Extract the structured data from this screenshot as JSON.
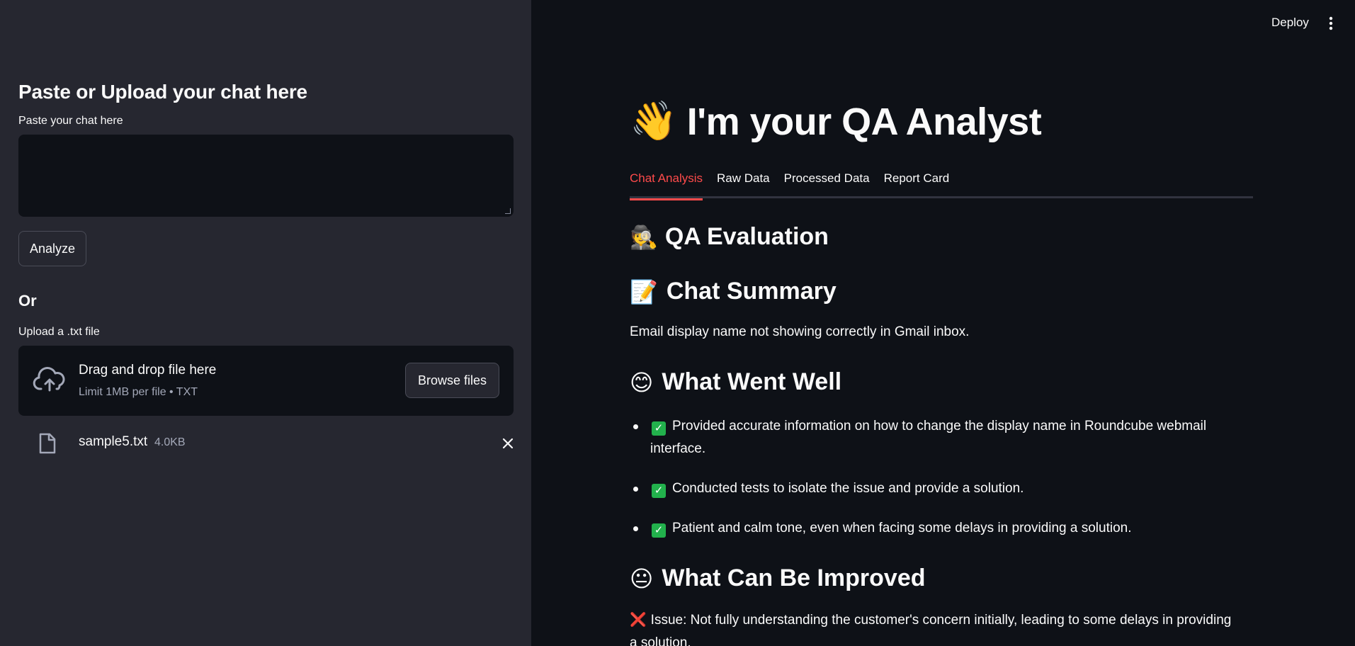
{
  "sidebar": {
    "title": "Paste or Upload your chat here",
    "paste_label": "Paste your chat here",
    "paste_value": "",
    "analyze_label": "Analyze",
    "or_label": "Or",
    "upload_label": "Upload a .txt file",
    "dropzone_title": "Drag and drop file here",
    "dropzone_sub": "Limit 1MB per file • TXT",
    "browse_label": "Browse files",
    "file": {
      "name": "sample5.txt",
      "size": "4.0KB"
    }
  },
  "header": {
    "deploy_label": "Deploy"
  },
  "main": {
    "title_emoji": "👋",
    "title": "I'm your QA Analyst",
    "tabs": [
      {
        "label": "Chat Analysis"
      },
      {
        "label": "Raw Data"
      },
      {
        "label": "Processed Data"
      },
      {
        "label": "Report Card"
      }
    ],
    "evaluation": {
      "emoji": "🕵️",
      "title": "QA Evaluation"
    },
    "summary": {
      "emoji": "📝",
      "title": "Chat Summary",
      "text": "Email display name not showing correctly in Gmail inbox."
    },
    "went_well": {
      "emoji": "😊",
      "title": "What Went Well",
      "items": [
        "Provided accurate information on how to change the display name in Roundcube webmail interface.",
        "Conducted tests to isolate the issue and provide a solution.",
        "Patient and calm tone, even when facing some delays in providing a solution."
      ]
    },
    "improve": {
      "emoji": "😐",
      "title": "What Can Be Improved",
      "issue_mark": "❌",
      "issue": "Issue: Not fully understanding the customer's concern initially, leading to some delays in providing a solution."
    }
  },
  "colors": {
    "accent": "#ff4b4b",
    "sidebar_bg": "#262730",
    "main_bg": "#0e1117"
  }
}
